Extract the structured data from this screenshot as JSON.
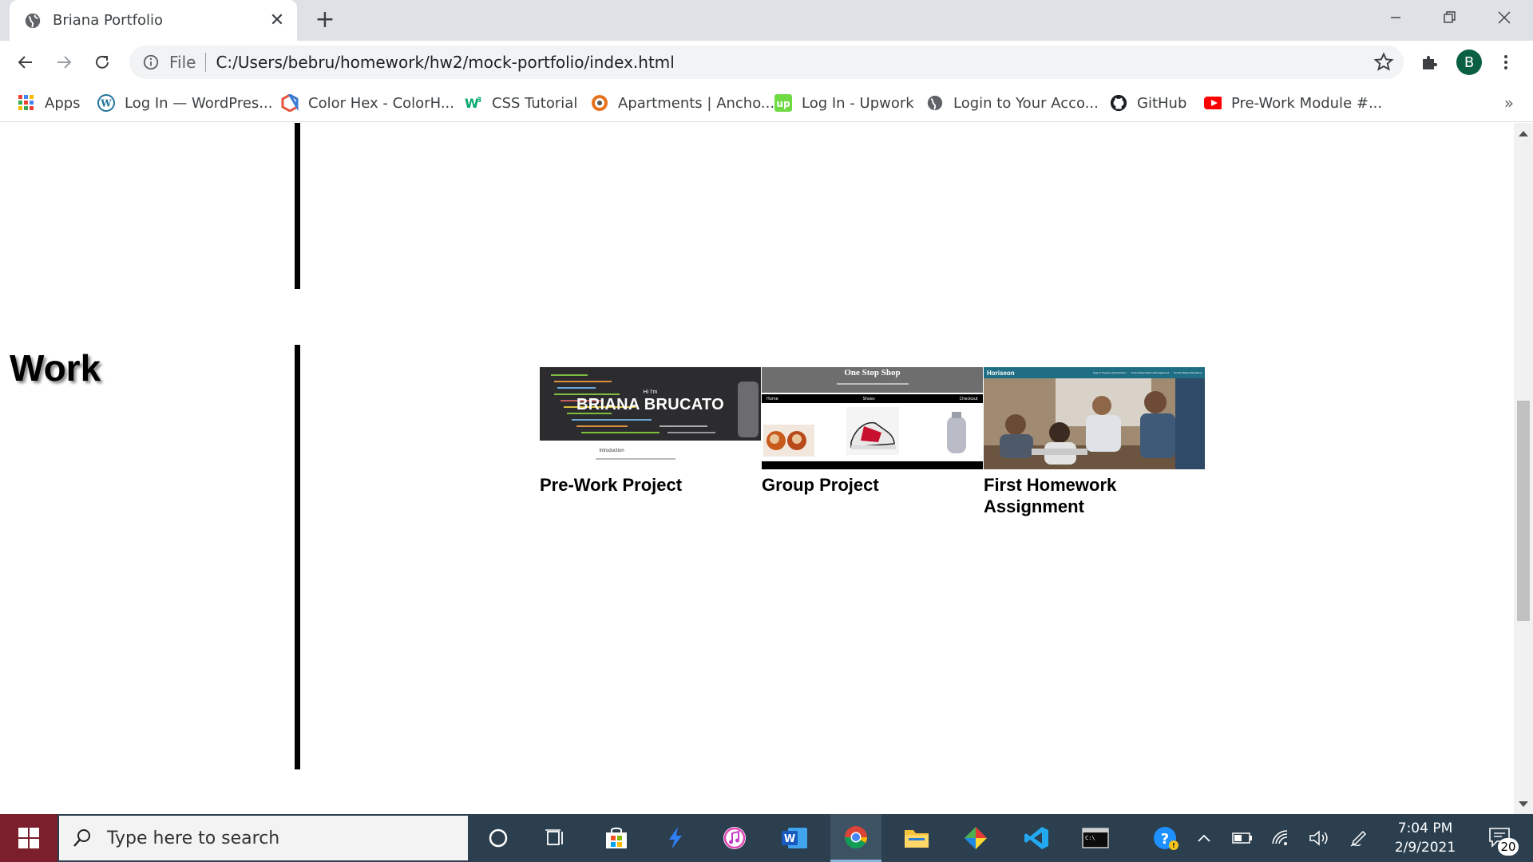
{
  "browser": {
    "tab_title": "Briana Portfolio",
    "url_scheme": "File",
    "url": "C:/Users/bebru/homework/hw2/mock-portfolio/index.html",
    "avatar_letter": "B",
    "bookmarks": [
      {
        "label": "Apps",
        "icon": "apps-grid-icon"
      },
      {
        "label": "Log In — WordPres...",
        "icon": "wordpress-icon"
      },
      {
        "label": "Color Hex - ColorH...",
        "icon": "colorhex-icon"
      },
      {
        "label": "CSS Tutorial",
        "icon": "w3schools-icon"
      },
      {
        "label": "Apartments | Ancho...",
        "icon": "apartments-icon"
      },
      {
        "label": "Log In - Upwork",
        "icon": "upwork-icon"
      },
      {
        "label": "Login to Your Acco...",
        "icon": "globe-icon"
      },
      {
        "label": "GitHub",
        "icon": "github-icon"
      },
      {
        "label": "Pre-Work Module #...",
        "icon": "youtube-icon"
      }
    ],
    "more_bookmarks": "»"
  },
  "page": {
    "section_title": "Work",
    "projects": [
      {
        "title": "Pre-Work Project",
        "thumb_greeting": "Hi I'm",
        "thumb_name": "BRIANA BRUCATO",
        "thumb_section": "Introduction"
      },
      {
        "title": "Group Project",
        "thumb_heading": "One Stop Shop",
        "thumb_nav": [
          "Home",
          "Shoes",
          "Checkout"
        ]
      },
      {
        "title": "First Homework Assignment",
        "thumb_brand": "Horiseon",
        "thumb_nav": [
          "Search Engine Optimization",
          "Online Reputation Management",
          "Social Media Marketing"
        ]
      }
    ]
  },
  "taskbar": {
    "search_placeholder": "Type here to search",
    "time": "7:04 PM",
    "date": "2/9/2021",
    "notifications": "20"
  },
  "colors": {
    "tabbar": "#dee1e6",
    "taskbar": "#2b3f4f",
    "start": "#7a1f2b",
    "avatar": "#0b5f43"
  }
}
